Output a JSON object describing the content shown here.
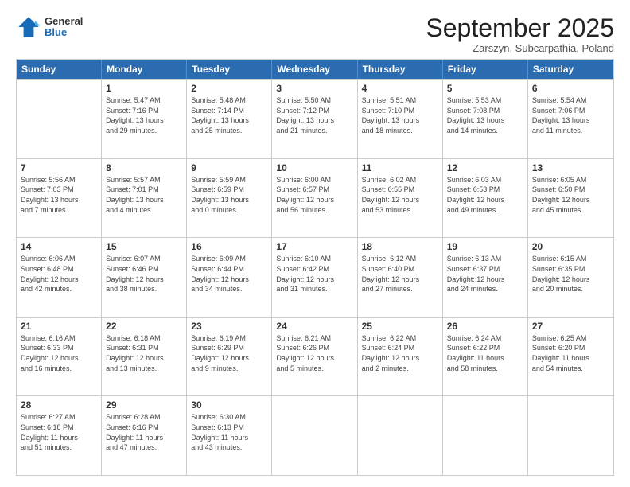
{
  "header": {
    "logo": {
      "general": "General",
      "blue": "Blue"
    },
    "title": "September 2025",
    "subtitle": "Zarszyn, Subcarpathia, Poland"
  },
  "calendar": {
    "days": [
      "Sunday",
      "Monday",
      "Tuesday",
      "Wednesday",
      "Thursday",
      "Friday",
      "Saturday"
    ],
    "rows": [
      [
        {
          "date": "",
          "info": ""
        },
        {
          "date": "1",
          "info": "Sunrise: 5:47 AM\nSunset: 7:16 PM\nDaylight: 13 hours\nand 29 minutes."
        },
        {
          "date": "2",
          "info": "Sunrise: 5:48 AM\nSunset: 7:14 PM\nDaylight: 13 hours\nand 25 minutes."
        },
        {
          "date": "3",
          "info": "Sunrise: 5:50 AM\nSunset: 7:12 PM\nDaylight: 13 hours\nand 21 minutes."
        },
        {
          "date": "4",
          "info": "Sunrise: 5:51 AM\nSunset: 7:10 PM\nDaylight: 13 hours\nand 18 minutes."
        },
        {
          "date": "5",
          "info": "Sunrise: 5:53 AM\nSunset: 7:08 PM\nDaylight: 13 hours\nand 14 minutes."
        },
        {
          "date": "6",
          "info": "Sunrise: 5:54 AM\nSunset: 7:06 PM\nDaylight: 13 hours\nand 11 minutes."
        }
      ],
      [
        {
          "date": "7",
          "info": "Sunrise: 5:56 AM\nSunset: 7:03 PM\nDaylight: 13 hours\nand 7 minutes."
        },
        {
          "date": "8",
          "info": "Sunrise: 5:57 AM\nSunset: 7:01 PM\nDaylight: 13 hours\nand 4 minutes."
        },
        {
          "date": "9",
          "info": "Sunrise: 5:59 AM\nSunset: 6:59 PM\nDaylight: 13 hours\nand 0 minutes."
        },
        {
          "date": "10",
          "info": "Sunrise: 6:00 AM\nSunset: 6:57 PM\nDaylight: 12 hours\nand 56 minutes."
        },
        {
          "date": "11",
          "info": "Sunrise: 6:02 AM\nSunset: 6:55 PM\nDaylight: 12 hours\nand 53 minutes."
        },
        {
          "date": "12",
          "info": "Sunrise: 6:03 AM\nSunset: 6:53 PM\nDaylight: 12 hours\nand 49 minutes."
        },
        {
          "date": "13",
          "info": "Sunrise: 6:05 AM\nSunset: 6:50 PM\nDaylight: 12 hours\nand 45 minutes."
        }
      ],
      [
        {
          "date": "14",
          "info": "Sunrise: 6:06 AM\nSunset: 6:48 PM\nDaylight: 12 hours\nand 42 minutes."
        },
        {
          "date": "15",
          "info": "Sunrise: 6:07 AM\nSunset: 6:46 PM\nDaylight: 12 hours\nand 38 minutes."
        },
        {
          "date": "16",
          "info": "Sunrise: 6:09 AM\nSunset: 6:44 PM\nDaylight: 12 hours\nand 34 minutes."
        },
        {
          "date": "17",
          "info": "Sunrise: 6:10 AM\nSunset: 6:42 PM\nDaylight: 12 hours\nand 31 minutes."
        },
        {
          "date": "18",
          "info": "Sunrise: 6:12 AM\nSunset: 6:40 PM\nDaylight: 12 hours\nand 27 minutes."
        },
        {
          "date": "19",
          "info": "Sunrise: 6:13 AM\nSunset: 6:37 PM\nDaylight: 12 hours\nand 24 minutes."
        },
        {
          "date": "20",
          "info": "Sunrise: 6:15 AM\nSunset: 6:35 PM\nDaylight: 12 hours\nand 20 minutes."
        }
      ],
      [
        {
          "date": "21",
          "info": "Sunrise: 6:16 AM\nSunset: 6:33 PM\nDaylight: 12 hours\nand 16 minutes."
        },
        {
          "date": "22",
          "info": "Sunrise: 6:18 AM\nSunset: 6:31 PM\nDaylight: 12 hours\nand 13 minutes."
        },
        {
          "date": "23",
          "info": "Sunrise: 6:19 AM\nSunset: 6:29 PM\nDaylight: 12 hours\nand 9 minutes."
        },
        {
          "date": "24",
          "info": "Sunrise: 6:21 AM\nSunset: 6:26 PM\nDaylight: 12 hours\nand 5 minutes."
        },
        {
          "date": "25",
          "info": "Sunrise: 6:22 AM\nSunset: 6:24 PM\nDaylight: 12 hours\nand 2 minutes."
        },
        {
          "date": "26",
          "info": "Sunrise: 6:24 AM\nSunset: 6:22 PM\nDaylight: 11 hours\nand 58 minutes."
        },
        {
          "date": "27",
          "info": "Sunrise: 6:25 AM\nSunset: 6:20 PM\nDaylight: 11 hours\nand 54 minutes."
        }
      ],
      [
        {
          "date": "28",
          "info": "Sunrise: 6:27 AM\nSunset: 6:18 PM\nDaylight: 11 hours\nand 51 minutes."
        },
        {
          "date": "29",
          "info": "Sunrise: 6:28 AM\nSunset: 6:16 PM\nDaylight: 11 hours\nand 47 minutes."
        },
        {
          "date": "30",
          "info": "Sunrise: 6:30 AM\nSunset: 6:13 PM\nDaylight: 11 hours\nand 43 minutes."
        },
        {
          "date": "",
          "info": ""
        },
        {
          "date": "",
          "info": ""
        },
        {
          "date": "",
          "info": ""
        },
        {
          "date": "",
          "info": ""
        }
      ]
    ]
  }
}
